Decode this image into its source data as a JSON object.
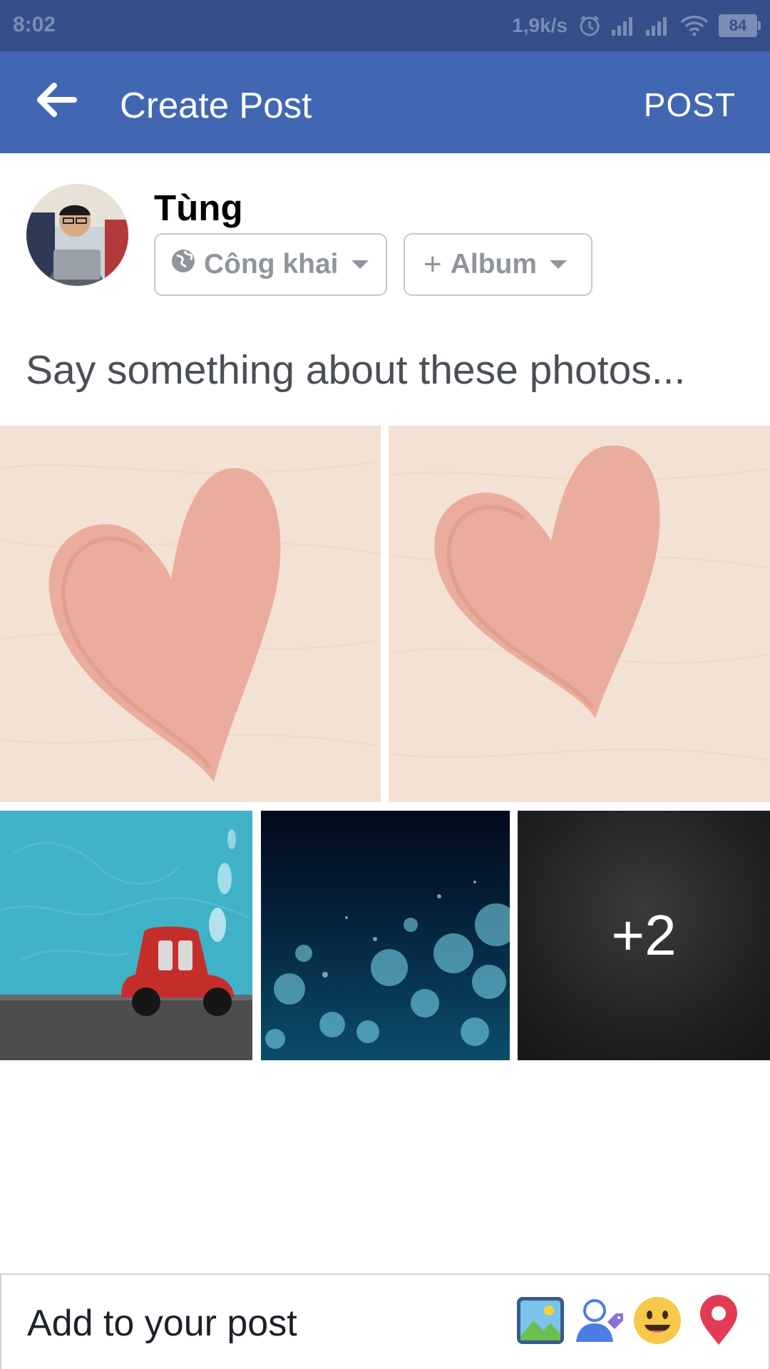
{
  "status_bar": {
    "time": "8:02",
    "network_speed": "1,9k/s",
    "battery": "84",
    "icons": [
      "alarm-icon",
      "signal-icon",
      "signal-icon",
      "wifi-icon",
      "battery-icon"
    ]
  },
  "app_bar": {
    "title": "Create Post",
    "post_label": "POST",
    "back_icon": "back-arrow-icon",
    "background_color": "#4267b2"
  },
  "user": {
    "name": "Tùng",
    "privacy_label": "Công khai",
    "privacy_icon": "globe-icon",
    "album_label": "Album",
    "album_icon": "plus-icon"
  },
  "composer": {
    "placeholder": "Say something about these photos..."
  },
  "photos": {
    "items": [
      "heart-photo",
      "heart-photo",
      "car-photo",
      "bokeh-photo",
      "dark-texture-photo"
    ],
    "more_count": "+2"
  },
  "bottom_bar": {
    "label": "Add to your post",
    "tools": [
      "photo-icon",
      "tag-people-icon",
      "feeling-emoji-icon",
      "location-pin-icon"
    ]
  }
}
